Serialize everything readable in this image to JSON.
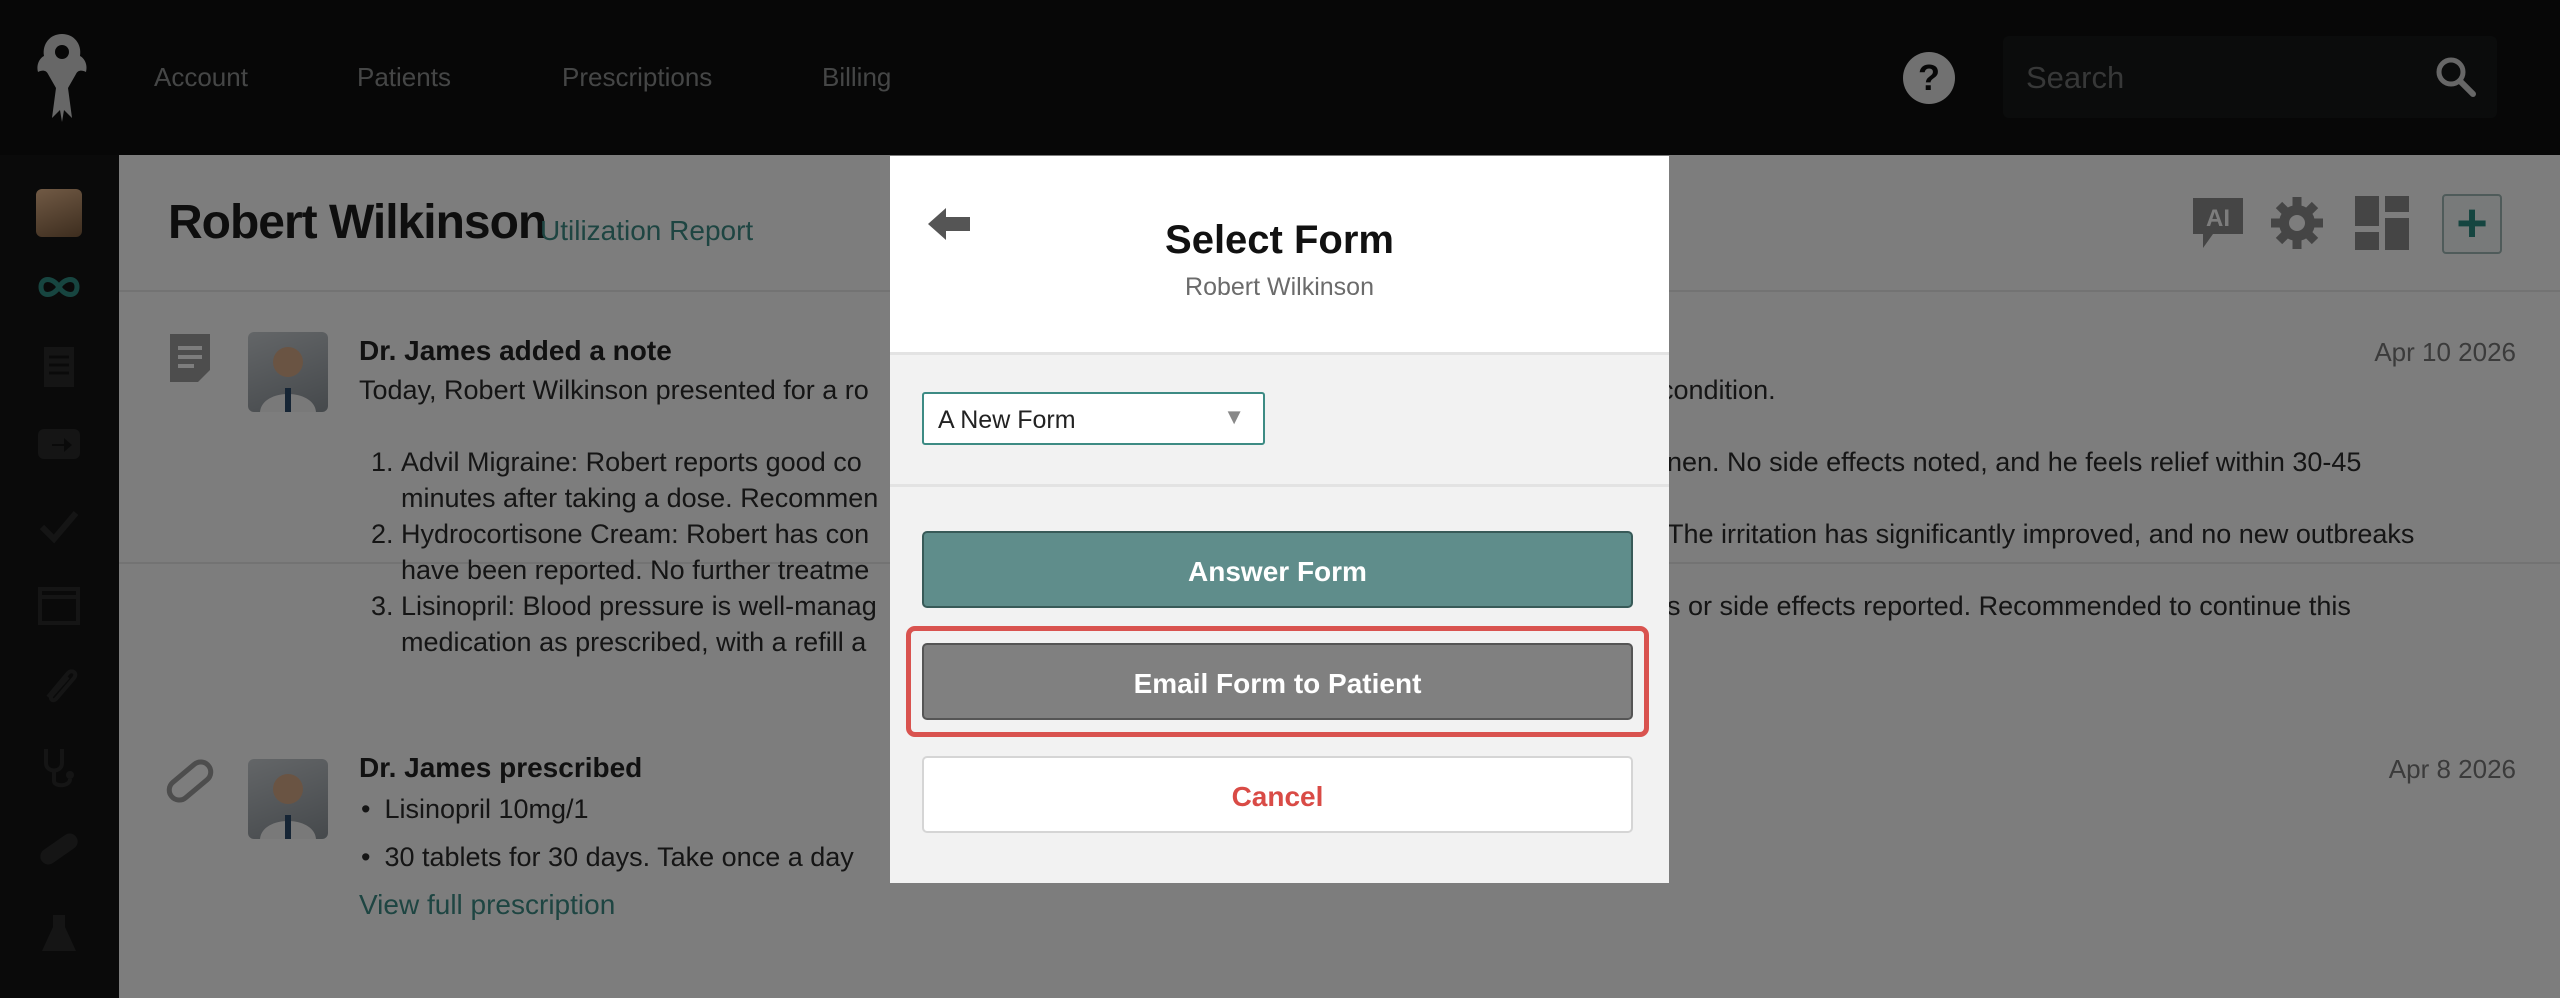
{
  "nav": {
    "links": [
      "Account",
      "Patients",
      "Prescriptions",
      "Billing"
    ],
    "help_label": "?",
    "search_placeholder": "Search"
  },
  "header": {
    "patient_name": "Robert Wilkinson",
    "report_link": "Utilization Report",
    "add_label": "+",
    "ai_label": "AI"
  },
  "feed": [
    {
      "title": "Dr. James added a note",
      "date": "Apr 10 2026",
      "intro": "Today, Robert Wilkinson presented for a ro",
      "intro_tail": "condition.",
      "items": [
        "Advil Migraine: Robert reports good co",
        "Hydrocortisone Cream: Robert has con",
        "Lisinopril: Blood pressure is well-manag"
      ],
      "items_line2": [
        "minutes after taking a dose. Recommen",
        "have been reported. No further treatme",
        "medication as prescribed, with a refill a"
      ],
      "items_right1": [
        "nen. No side effects noted, and he feels relief within 30-45",
        "The irritation has significantly improved, and no new outbreaks",
        "s or side effects reported. Recommended to continue this"
      ]
    },
    {
      "title": "Dr. James prescribed",
      "date": "Apr 8 2026",
      "lines": [
        "Lisinopril 10mg/1",
        "30 tablets for 30 days. Take once a day"
      ],
      "link": "View full prescription"
    }
  ],
  "modal": {
    "title": "Select Form",
    "subtitle": "Robert Wilkinson",
    "select_value": "A New Form",
    "answer_button": "Answer Form",
    "email_button": "Email Form to Patient",
    "cancel_button": "Cancel"
  },
  "colors": {
    "accent": "#3d8b84",
    "answer_bg": "#5f8d8b",
    "email_bg": "#808080",
    "cancel_text": "#d94b46",
    "highlight": "#d9534f"
  }
}
